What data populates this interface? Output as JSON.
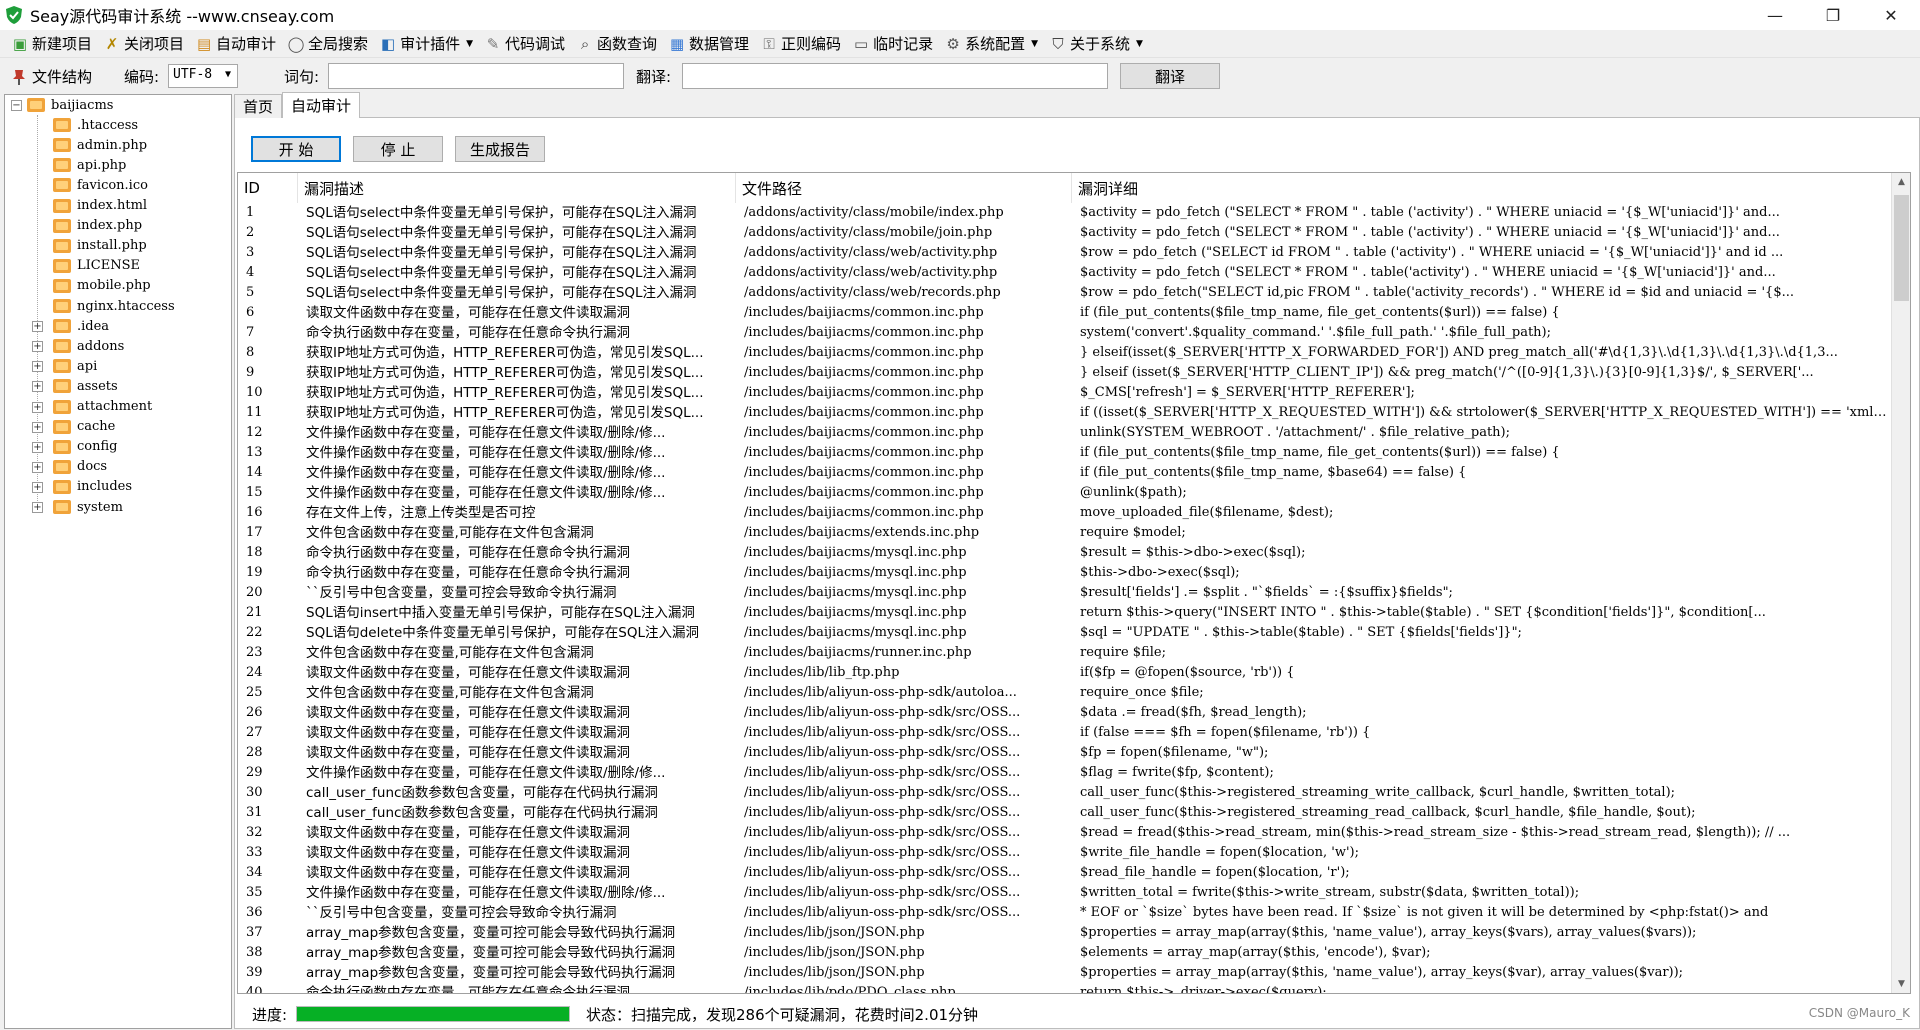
{
  "window": {
    "title": "Seay源代码审计系统 --www.cnseay.com",
    "minimize": "—",
    "restore": "❐",
    "close": "✕"
  },
  "menu": [
    {
      "label": "新建项目",
      "icon": "new-project-icon"
    },
    {
      "label": "关闭项目",
      "icon": "close-project-icon"
    },
    {
      "label": "自动审计",
      "icon": "auto-audit-icon"
    },
    {
      "label": "全局搜索",
      "icon": "global-search-icon"
    },
    {
      "label": "审计插件",
      "icon": "plugin-icon",
      "dropdown": true
    },
    {
      "label": "代码调试",
      "icon": "debug-icon"
    },
    {
      "label": "函数查询",
      "icon": "function-search-icon"
    },
    {
      "label": "数据管理",
      "icon": "data-manage-icon"
    },
    {
      "label": "正则编码",
      "icon": "regex-encode-icon"
    },
    {
      "label": "临时记录",
      "icon": "temp-record-icon"
    },
    {
      "label": "系统配置",
      "icon": "gear-icon",
      "dropdown": true
    },
    {
      "label": "关于系统",
      "icon": "about-icon",
      "dropdown": true
    }
  ],
  "toolbar": {
    "file_structure": "文件结构",
    "encoding_label": "编码:",
    "encoding_value": "UTF-8",
    "word_label": "词句:",
    "word_value": "",
    "translate_label": "翻译:",
    "translate_value": "",
    "translate_button": "翻译"
  },
  "tree": {
    "root": "baijiacms",
    "files": [
      ".htaccess",
      "admin.php",
      "api.php",
      "favicon.ico",
      "index.html",
      "index.php",
      "install.php",
      "LICENSE",
      "mobile.php",
      "nginx.htaccess"
    ],
    "folders": [
      ".idea",
      "addons",
      "api",
      "assets",
      "attachment",
      "cache",
      "config",
      "docs",
      "includes",
      "system"
    ]
  },
  "tabs": [
    "首页",
    "自动审计"
  ],
  "actions": {
    "start": "开 始",
    "stop": "停 止",
    "report": "生成报告"
  },
  "table": {
    "headers": [
      "ID",
      "漏洞描述",
      "文件路径",
      "漏洞详细"
    ],
    "rows": [
      [
        "1",
        "SQL语句select中条件变量无单引号保护，可能存在SQL注入漏洞",
        "/addons/activity/class/mobile/index.php",
        "$activity = pdo_fetch (\"SELECT * FROM \" . table ('activity') . \" WHERE uniacid = '{$_W['uniacid']}' and..."
      ],
      [
        "2",
        "SQL语句select中条件变量无单引号保护，可能存在SQL注入漏洞",
        "/addons/activity/class/mobile/join.php",
        "$activity = pdo_fetch (\"SELECT * FROM \" . table ('activity') . \" WHERE uniacid = '{$_W['uniacid']}' and..."
      ],
      [
        "3",
        "SQL语句select中条件变量无单引号保护，可能存在SQL注入漏洞",
        "/addons/activity/class/web/activity.php",
        "$row = pdo_fetch (\"SELECT id FROM \" . table ('activity') . \" WHERE uniacid = '{$_W['uniacid']}' and id ..."
      ],
      [
        "4",
        "SQL语句select中条件变量无单引号保护，可能存在SQL注入漏洞",
        "/addons/activity/class/web/activity.php",
        "$activity = pdo_fetch (\"SELECT * FROM \" . table('activity') . \" WHERE  uniacid = '{$_W['uniacid']}' and..."
      ],
      [
        "5",
        "SQL语句select中条件变量无单引号保护，可能存在SQL注入漏洞",
        "/addons/activity/class/web/records.php",
        "$row = pdo_fetch(\"SELECT id,pic FROM \" . table('activity_records') . \" WHERE id = $id and uniacid = '{$..."
      ],
      [
        "6",
        "读取文件函数中存在变量，可能存在任意文件读取漏洞",
        "/includes/baijiacms/common.inc.php",
        "if (file_put_contents($file_tmp_name, file_get_contents($url)) == false) {"
      ],
      [
        "7",
        "命令执行函数中存在变量，可能存在任意命令执行漏洞",
        "/includes/baijiacms/common.inc.php",
        "system('convert'.$quality_command.' '.$file_full_path.' '.$file_full_path);"
      ],
      [
        "8",
        "获取IP地址方式可伪造，HTTP_REFERER可伪造，常见引发SQL...",
        "/includes/baijiacms/common.inc.php",
        "} elseif(isset($_SERVER['HTTP_X_FORWARDED_FOR']) AND preg_match_all('#\\d{1,3}\\.\\d{1,3}\\.\\d{1,3}\\.\\d{1,3..."
      ],
      [
        "9",
        "获取IP地址方式可伪造，HTTP_REFERER可伪造，常见引发SQL...",
        "/includes/baijiacms/common.inc.php",
        "} elseif (isset($_SERVER['HTTP_CLIENT_IP']) && preg_match('/^([0-9]{1,3}\\.){3}[0-9]{1,3}$/', $_SERVER['..."
      ],
      [
        "10",
        "获取IP地址方式可伪造，HTTP_REFERER可伪造，常见引发SQL...",
        "/includes/baijiacms/common.inc.php",
        "$_CMS['refresh'] =  $_SERVER['HTTP_REFERER'];"
      ],
      [
        "11",
        "获取IP地址方式可伪造，HTTP_REFERER可伪造，常见引发SQL...",
        "/includes/baijiacms/common.inc.php",
        "if ((isset($_SERVER['HTTP_X_REQUESTED_WITH']) && strtolower($_SERVER['HTTP_X_REQUESTED_WITH']) == 'xmlh..."
      ],
      [
        "12",
        "文件操作函数中存在变量，可能存在任意文件读取/删除/修...",
        "/includes/baijiacms/common.inc.php",
        "unlink(SYSTEM_WEBROOT . '/attachment/' . $file_relative_path);"
      ],
      [
        "13",
        "文件操作函数中存在变量，可能存在任意文件读取/删除/修...",
        "/includes/baijiacms/common.inc.php",
        "if (file_put_contents($file_tmp_name, file_get_contents($url)) == false) {"
      ],
      [
        "14",
        "文件操作函数中存在变量，可能存在任意文件读取/删除/修...",
        "/includes/baijiacms/common.inc.php",
        "if (file_put_contents($file_tmp_name, $base64) == false) {"
      ],
      [
        "15",
        "文件操作函数中存在变量，可能存在任意文件读取/删除/修...",
        "/includes/baijiacms/common.inc.php",
        "@unlink($path);"
      ],
      [
        "16",
        "存在文件上传，注意上传类型是否可控",
        "/includes/baijiacms/common.inc.php",
        "move_uploaded_file($filename, $dest);"
      ],
      [
        "17",
        "文件包含函数中存在变量,可能存在文件包含漏洞",
        "/includes/baijiacms/extends.inc.php",
        "require $model;"
      ],
      [
        "18",
        "命令执行函数中存在变量，可能存在任意命令执行漏洞",
        "/includes/baijiacms/mysql.inc.php",
        "$result = $this->dbo->exec($sql);"
      ],
      [
        "19",
        "命令执行函数中存在变量，可能存在任意命令执行漏洞",
        "/includes/baijiacms/mysql.inc.php",
        "$this->dbo->exec($sql);"
      ],
      [
        "20",
        "``反引号中包含变量，变量可控会导致命令执行漏洞",
        "/includes/baijiacms/mysql.inc.php",
        "$result['fields'] .= $split . \"`$fields` = :{$suffix}$fields\";"
      ],
      [
        "21",
        "SQL语句insert中插入变量无单引号保护，可能存在SQL注入漏洞",
        "/includes/baijiacms/mysql.inc.php",
        "return $this->query(\"INSERT INTO \" . $this->table($table) . \" SET {$condition['fields']}\", $condition[..."
      ],
      [
        "22",
        "SQL语句delete中条件变量无单引号保护，可能存在SQL注入漏洞",
        "/includes/baijiacms/mysql.inc.php",
        "$sql = \"UPDATE \" . $this->table($table) . \" SET {$fields['fields']}\";"
      ],
      [
        "23",
        "文件包含函数中存在变量,可能存在文件包含漏洞",
        "/includes/baijiacms/runner.inc.php",
        "require $file;"
      ],
      [
        "24",
        "读取文件函数中存在变量，可能存在任意文件读取漏洞",
        "/includes/lib/lib_ftp.php",
        "if($fp = @fopen($source, 'rb')) {"
      ],
      [
        "25",
        "文件包含函数中存在变量,可能存在文件包含漏洞",
        "/includes/lib/aliyun-oss-php-sdk/autoloa...",
        "require_once $file;"
      ],
      [
        "26",
        "读取文件函数中存在变量，可能存在任意文件读取漏洞",
        "/includes/lib/aliyun-oss-php-sdk/src/OSS...",
        "$data .= fread($fh, $read_length);"
      ],
      [
        "27",
        "读取文件函数中存在变量，可能存在任意文件读取漏洞",
        "/includes/lib/aliyun-oss-php-sdk/src/OSS...",
        "if (false === $fh = fopen($filename, 'rb')) {"
      ],
      [
        "28",
        "读取文件函数中存在变量，可能存在任意文件读取漏洞",
        "/includes/lib/aliyun-oss-php-sdk/src/OSS...",
        "$fp = fopen($filename, \"w\");"
      ],
      [
        "29",
        "文件操作函数中存在变量，可能存在任意文件读取/删除/修...",
        "/includes/lib/aliyun-oss-php-sdk/src/OSS...",
        "$flag = fwrite($fp, $content);"
      ],
      [
        "30",
        "call_user_func函数参数包含变量，可能存在代码执行漏洞",
        "/includes/lib/aliyun-oss-php-sdk/src/OSS...",
        "call_user_func($this->registered_streaming_write_callback, $curl_handle, $written_total);"
      ],
      [
        "31",
        "call_user_func函数参数包含变量，可能存在代码执行漏洞",
        "/includes/lib/aliyun-oss-php-sdk/src/OSS...",
        "call_user_func($this->registered_streaming_read_callback, $curl_handle, $file_handle, $out);"
      ],
      [
        "32",
        "读取文件函数中存在变量，可能存在任意文件读取漏洞",
        "/includes/lib/aliyun-oss-php-sdk/src/OSS...",
        "$read = fread($this->read_stream, min($this->read_stream_size - $this->read_stream_read, $length)); // ..."
      ],
      [
        "33",
        "读取文件函数中存在变量，可能存在任意文件读取漏洞",
        "/includes/lib/aliyun-oss-php-sdk/src/OSS...",
        "$write_file_handle = fopen($location, 'w');"
      ],
      [
        "34",
        "读取文件函数中存在变量，可能存在任意文件读取漏洞",
        "/includes/lib/aliyun-oss-php-sdk/src/OSS...",
        "$read_file_handle = fopen($location, 'r');"
      ],
      [
        "35",
        "文件操作函数中存在变量，可能存在任意文件读取/删除/修...",
        "/includes/lib/aliyun-oss-php-sdk/src/OSS...",
        "$written_total = fwrite($this->write_stream, substr($data, $written_total));"
      ],
      [
        "36",
        "``反引号中包含变量，变量可控会导致命令执行漏洞",
        "/includes/lib/aliyun-oss-php-sdk/src/OSS...",
        "* EOF or `$size` bytes have been read. If `$size` is not given it will be determined by <php:fstat()> and"
      ],
      [
        "37",
        "array_map参数包含变量，变量可控可能会导致代码执行漏洞",
        "/includes/lib/json/JSON.php",
        "$properties = array_map(array($this, 'name_value'), array_keys($vars), array_values($vars));"
      ],
      [
        "38",
        "array_map参数包含变量，变量可控可能会导致代码执行漏洞",
        "/includes/lib/json/JSON.php",
        "$elements = array_map(array($this, 'encode'), $var);"
      ],
      [
        "39",
        "array_map参数包含变量，变量可控可能会导致代码执行漏洞",
        "/includes/lib/json/JSON.php",
        "$properties = array_map(array($this, 'name_value'), array_keys($var), array_values($var));"
      ],
      [
        "40",
        "命令执行函数中存在变量，可能存在任意命令执行漏洞",
        "/includes/lib/pdo/PDO_class.php",
        "return $this->_driver->exec($query);"
      ]
    ]
  },
  "status": {
    "progress_label": "进度:",
    "progress": 1.0,
    "text": "状态：扫描完成，发现286个可疑漏洞，花费时间2.01分钟"
  },
  "watermark": "CSDN @Mauro_K",
  "colors": {
    "progress": "#06b025",
    "accent": "#0078d7",
    "folder": "#f0a33a"
  }
}
